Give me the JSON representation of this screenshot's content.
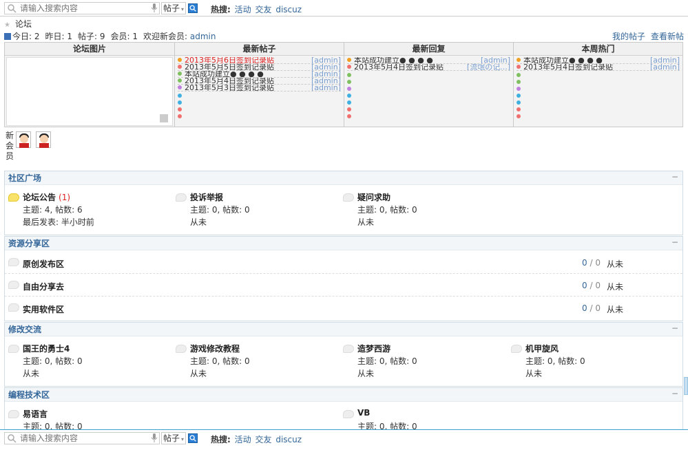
{
  "search": {
    "placeholder": "请输入搜索内容",
    "type": "帖子",
    "hot_label": "热搜:",
    "hot_links": [
      "活动",
      "交友",
      "discuz"
    ]
  },
  "breadcrumb": {
    "home": "论坛"
  },
  "stats": {
    "today": "今日: 2",
    "yesterday": "昨日: 1",
    "posts": "帖子: 9",
    "members": "会员: 1",
    "welcome": "欢迎新会员:",
    "newest_member": "admin",
    "my_posts": "我的帖子",
    "new_posts": "查看新帖"
  },
  "grid": {
    "headers": [
      "论坛图片",
      "最新帖子",
      "最新回复",
      "本周热门"
    ],
    "latest_posts": [
      {
        "title": "2013年5月6日签到记录贴",
        "author": "[admin]",
        "red": true
      },
      {
        "title": "2013年5月5日签到记录贴",
        "author": "[admin]",
        "red": false
      },
      {
        "title": "本站成功建立● ● ● ●",
        "author": "[admin]",
        "red": false
      },
      {
        "title": "2013年5月4日签到记录贴",
        "author": "[admin]",
        "red": false
      },
      {
        "title": "2013年5月3日签到记录贴",
        "author": "[admin]",
        "red": false
      }
    ],
    "latest_replies": [
      {
        "title": "本站成功建立● ● ● ●",
        "author": "[admin]"
      },
      {
        "title": "2013年5月4日签到记录贴",
        "author": "[流氓の记...]"
      }
    ],
    "hot": [
      {
        "title": "本站成功建立● ● ● ●",
        "author": "[admin]"
      },
      {
        "title": "2013年5月4日签到记录贴",
        "author": "[admin]"
      }
    ],
    "dot_colors": [
      "#f0a020",
      "#f07070",
      "#80c060",
      "#80c060",
      "#c080e0",
      "#40b0e0",
      "#40b0e0",
      "#f07070",
      "#f07070"
    ]
  },
  "new_members": {
    "label": "新会员"
  },
  "sections": {
    "community": {
      "title": "社区广场",
      "forums": [
        {
          "name": "论坛公告",
          "count": "(1)",
          "stats": "主题: 4, 帖数: 6",
          "last": "最后发表: 半小时前",
          "new": true
        },
        {
          "name": "投诉举报",
          "count": "",
          "stats": "主题: 0, 帖数: 0",
          "last": "从未",
          "new": false
        },
        {
          "name": "疑问求助",
          "count": "",
          "stats": "主题: 0, 帖数: 0",
          "last": "从未",
          "new": false
        }
      ]
    },
    "resources": {
      "title": "资源分享区",
      "forums": [
        {
          "name": "原创发布区",
          "threads": "0",
          "posts": "0",
          "last": "从未"
        },
        {
          "name": "自由分享去",
          "threads": "0",
          "posts": "0",
          "last": "从未"
        },
        {
          "name": "实用软件区",
          "threads": "0",
          "posts": "0",
          "last": "从未"
        }
      ]
    },
    "modding": {
      "title": "修改交流",
      "forums": [
        {
          "name": "国王的勇士4",
          "stats": "主题: 0, 帖数: 0",
          "last": "从未"
        },
        {
          "name": "游戏修改教程",
          "stats": "主题: 0, 帖数: 0",
          "last": "从未"
        },
        {
          "name": "造梦西游",
          "stats": "主题: 0, 帖数: 0",
          "last": "从未"
        },
        {
          "name": "机甲旋风",
          "stats": "主题: 0, 帖数: 0",
          "last": "从未"
        }
      ]
    },
    "programming": {
      "title": "编程技术区",
      "forums": [
        {
          "name": "易语言",
          "stats": "主题: 0, 帖数: 0"
        },
        {
          "name": "VB",
          "stats": "主题: 0, 帖数: 0"
        }
      ]
    }
  },
  "toggle": "−",
  "slash": "/"
}
